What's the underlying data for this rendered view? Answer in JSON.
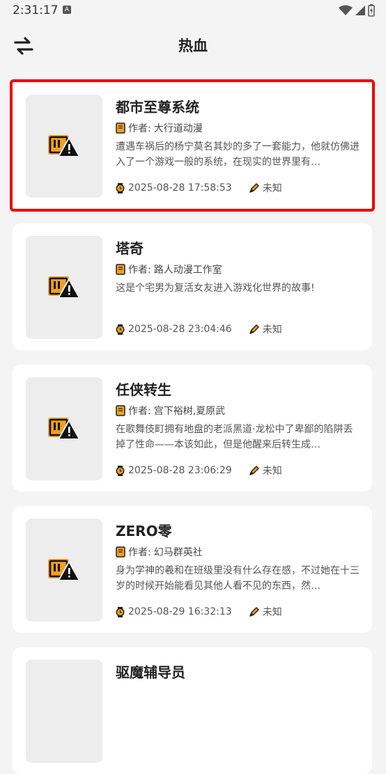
{
  "status_bar": {
    "time": "2:31:17",
    "badge": "A"
  },
  "header": {
    "title": "热血"
  },
  "author_prefix": "作者: ",
  "cards": [
    {
      "title": "都市至尊系统",
      "author": "大行道动漫",
      "description": "遭遇车祸后的杨宁莫名其妙的多了一套能力，他就仿佛进入了一个游戏一般的系统，在现实的世界里有…",
      "time": "2025-08-28 17:58:53",
      "status": "未知"
    },
    {
      "title": "塔奇",
      "author": "路人动漫工作室",
      "description": "这是个宅男为复活女友进入游戏化世界的故事!",
      "time": "2025-08-28 23:04:46",
      "status": "未知"
    },
    {
      "title": "任侠转生",
      "author": "宫下裕树,夏原武",
      "description": "在歌舞伎町拥有地盘的老派黑道·龙松中了卑鄙的陷阱丢掉了性命——本该如此，但是他醒来后转生成…",
      "time": "2025-08-28 23:06:29",
      "status": "未知"
    },
    {
      "title": "ZERO零",
      "author": "幻马群英社",
      "description": "身为学神的羲和在班级里没有什么存在感，不过她在十三岁的时候开始能看见其他人看不见的东西，然…",
      "time": "2025-08-29 16:32:13",
      "status": "未知"
    },
    {
      "title": "驱魔辅导员",
      "author": "",
      "description": "",
      "time": "",
      "status": ""
    }
  ],
  "colors": {
    "selected_border": "#ee0000",
    "icon_orange": "#f0a020",
    "background": "#f4f4f4"
  }
}
